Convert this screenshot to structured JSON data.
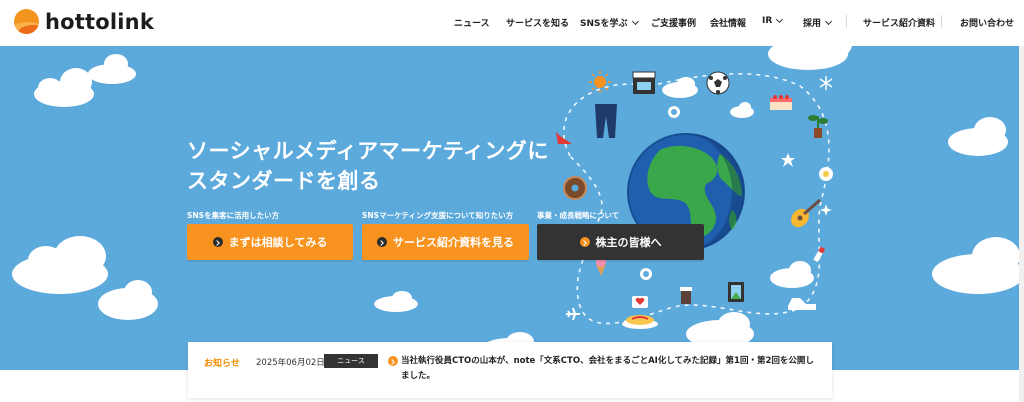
{
  "header": {
    "logo_text": "hottolink",
    "nav": [
      {
        "label": "ニュース",
        "has_dropdown": false
      },
      {
        "label": "サービスを知る",
        "has_dropdown": false
      },
      {
        "label": "SNSを学ぶ",
        "has_dropdown": true
      },
      {
        "label": "ご支援事例",
        "has_dropdown": false
      },
      {
        "label": "会社情報",
        "has_dropdown": false
      },
      {
        "label": "IR",
        "has_dropdown": true
      },
      {
        "label": "採用",
        "has_dropdown": true
      },
      {
        "label": "サービス紹介資料",
        "has_dropdown": false
      },
      {
        "label": "お問い合わせ",
        "has_dropdown": false
      }
    ]
  },
  "hero": {
    "title_line1": "ソーシャルメディアマーケティングに",
    "title_line2": "スタンダードを創る",
    "ctas": [
      {
        "caption": "SNSを集客に活用したい方",
        "label": "まずは相談してみる",
        "style": "orange"
      },
      {
        "caption": "SNSマーケティング支援について知りたい方",
        "label": "サービス紹介資料を見る",
        "style": "orange"
      },
      {
        "caption": "事業・成長戦略について",
        "label": "株主の皆様へ",
        "style": "dark"
      }
    ]
  },
  "news": {
    "label": "お知らせ",
    "date": "2025年06月02日",
    "tag": "ニュース",
    "text": "当社執行役員CTOの山本が、note「文系CTO、会社をまるごとAI化してみた記録」第1回・第2回を公開しました。"
  },
  "colors": {
    "hero_bg": "#5ca9dc",
    "accent_orange": "#f7931e",
    "dark_button": "#333333",
    "news_label": "#f08c00"
  }
}
